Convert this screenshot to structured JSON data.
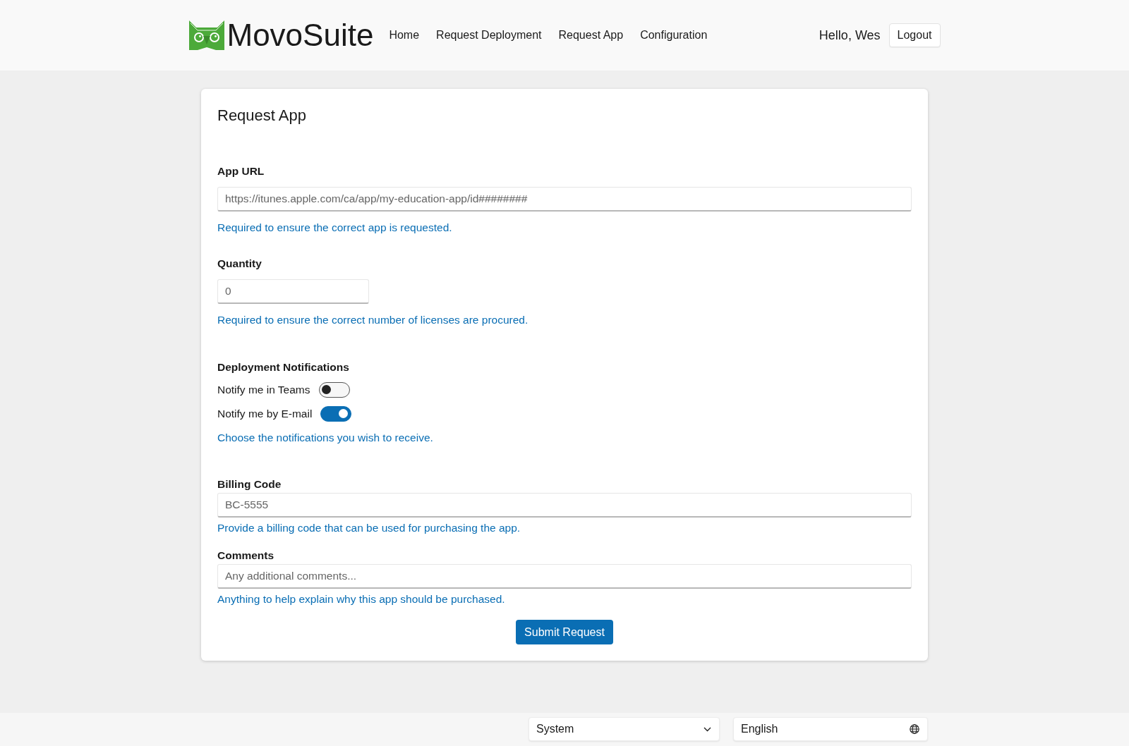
{
  "header": {
    "logo_text": "MovoSuite",
    "nav": [
      {
        "label": "Home"
      },
      {
        "label": "Request Deployment"
      },
      {
        "label": "Request App"
      },
      {
        "label": "Configuration"
      }
    ],
    "greeting": "Hello, Wes",
    "logout": "Logout"
  },
  "card": {
    "title": "Request App",
    "fields": [
      {
        "kind": "url",
        "label": "App URL",
        "placeholder": "https://itunes.apple.com/ca/app/my-education-app/id########",
        "help": "Required to ensure the correct app is requested."
      },
      {
        "kind": "number",
        "label": "Quantity",
        "placeholder": "0",
        "help": "Required to ensure the correct number of licenses are procured."
      },
      {
        "kind": "toggles",
        "label": "Deployment Notifications",
        "toggles": [
          {
            "label": "Notify me in Teams",
            "checked": false
          },
          {
            "label": "Notify me by E-mail",
            "checked": true
          }
        ],
        "help": "Choose the notifications you wish to receive."
      },
      {
        "kind": "text",
        "label": "Billing Code",
        "placeholder": "BC-5555",
        "help": "Provide a billing code that can be used for purchasing the app."
      },
      {
        "kind": "text",
        "label": "Comments",
        "placeholder": "Any additional comments...",
        "help": "Anything to help explain why this app should be purchased."
      }
    ],
    "submit": "Submit Request"
  },
  "footer": {
    "theme_select": {
      "value": "System"
    },
    "language_select": {
      "value": "English"
    }
  }
}
